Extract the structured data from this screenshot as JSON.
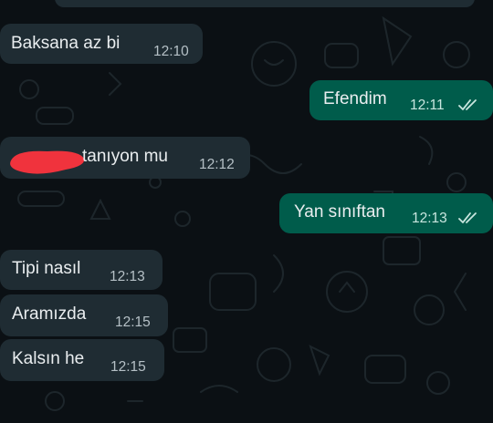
{
  "chat": {
    "messages": [
      {
        "id": "m1",
        "direction": "incoming",
        "text": "Baksana az bi",
        "time": "12:10"
      },
      {
        "id": "m2",
        "direction": "outgoing",
        "text": "Efendim",
        "time": "12:11",
        "status": "read"
      },
      {
        "id": "m3",
        "direction": "incoming",
        "text": "tanıyon mu",
        "time": "12:12",
        "redacted_prefix": true
      },
      {
        "id": "m4",
        "direction": "outgoing",
        "text": "Yan sınıftan",
        "time": "12:13",
        "status": "read"
      },
      {
        "id": "m5",
        "direction": "incoming",
        "text": "Tipi nasıl",
        "time": "12:13"
      },
      {
        "id": "m6",
        "direction": "incoming",
        "text": "Aramızda",
        "time": "12:15"
      },
      {
        "id": "m7",
        "direction": "incoming",
        "text": "Kalsın he",
        "time": "12:15"
      }
    ]
  },
  "colors": {
    "background": "#0b1014",
    "incoming_bubble": "#1f2c33",
    "outgoing_bubble": "#005c4b",
    "read_ticks": "#c9e6df",
    "redaction": "#f0333d"
  },
  "icons": {
    "read_receipt": "double-check-icon",
    "wallpaper": "chat-doodle-pattern"
  }
}
